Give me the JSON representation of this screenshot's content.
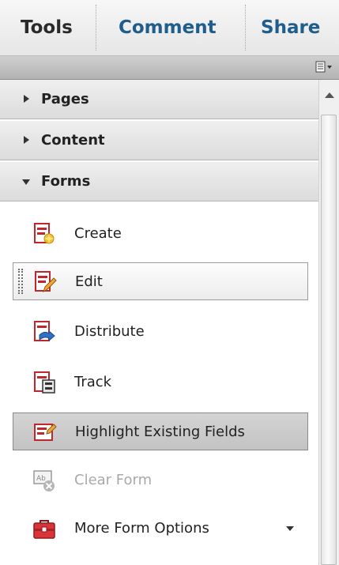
{
  "tabs": [
    {
      "label": "Tools"
    },
    {
      "label": "Comment"
    },
    {
      "label": "Share"
    }
  ],
  "options_icon": "panel-options-icon",
  "sections": [
    {
      "label": "Pages",
      "expanded": false
    },
    {
      "label": "Content",
      "expanded": false
    },
    {
      "label": "Forms",
      "expanded": true
    }
  ],
  "forms_items": [
    {
      "label": "Create",
      "icon": "form-create-icon"
    },
    {
      "label": "Edit",
      "icon": "form-edit-icon",
      "state": "selected"
    },
    {
      "label": "Distribute",
      "icon": "form-distribute-icon"
    },
    {
      "label": "Track",
      "icon": "form-track-icon"
    },
    {
      "label": "Highlight Existing Fields",
      "icon": "highlight-fields-icon",
      "state": "highlighted"
    },
    {
      "label": "Clear Form",
      "icon": "clear-form-icon",
      "state": "disabled"
    },
    {
      "label": "More Form Options",
      "icon": "toolbox-icon",
      "has_dropdown": true
    }
  ],
  "colors": {
    "tab_text": "#1f5d8d",
    "active_tab_text": "#2a2a2a",
    "icon_red": "#c0262c",
    "icon_blue": "#2f6fc4"
  }
}
